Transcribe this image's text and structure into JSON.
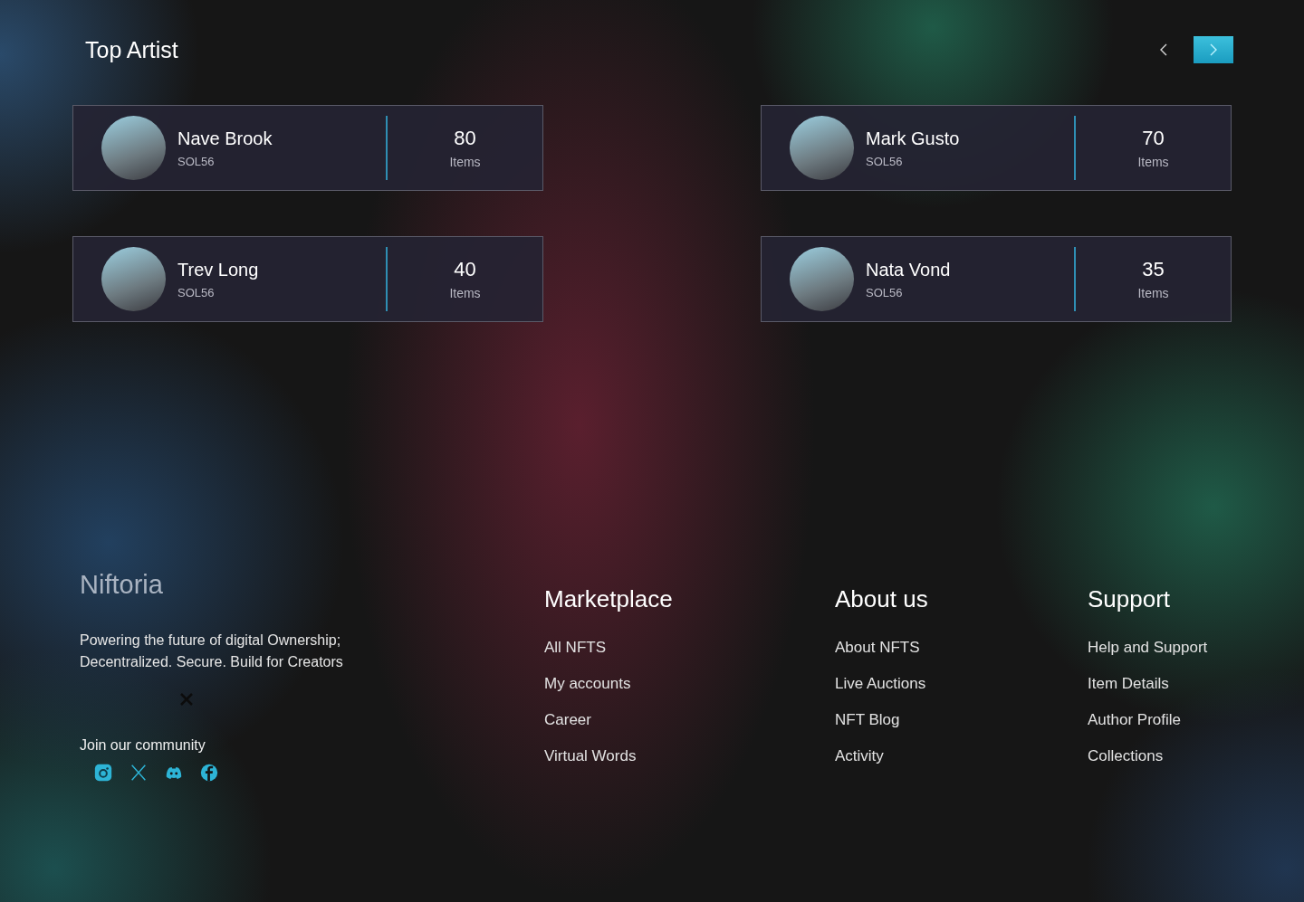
{
  "top_artists": {
    "title": "Top Artist",
    "nav_buttons": [
      {
        "kind": "prev",
        "active": false
      },
      {
        "kind": "next",
        "active": true
      }
    ],
    "artists": [
      {
        "name": "Nave Brook",
        "handle": "SOL56",
        "count": "80",
        "count_label": "Items"
      },
      {
        "name": "Mark Gusto",
        "handle": "SOL56",
        "count": "70",
        "count_label": "Items"
      },
      {
        "name": "Trev Long",
        "handle": "SOL56",
        "count": "40",
        "count_label": "Items"
      },
      {
        "name": "Nata Vond",
        "handle": "SOL56",
        "count": "35",
        "count_label": "Items"
      }
    ]
  },
  "footer": {
    "brand": "Niftoria",
    "tagline": "Powering the future of digital Ownership; Decentralized. Secure. Build for Creators",
    "community_label": "Join our community",
    "socials": [
      {
        "kind": "instagram"
      },
      {
        "kind": "x"
      },
      {
        "kind": "discord"
      },
      {
        "kind": "facebook"
      }
    ],
    "columns": [
      {
        "heading": "Marketplace",
        "links": [
          "All NFTS",
          "My accounts",
          "Career",
          "Virtual Words"
        ]
      },
      {
        "heading": "About us",
        "links": [
          "About NFTS",
          "Live Auctions",
          "NFT Blog",
          "Activity"
        ]
      },
      {
        "heading": "Support",
        "links": [
          "Help and Support",
          "Item Details",
          "Author Profile",
          "Collections"
        ]
      }
    ]
  }
}
